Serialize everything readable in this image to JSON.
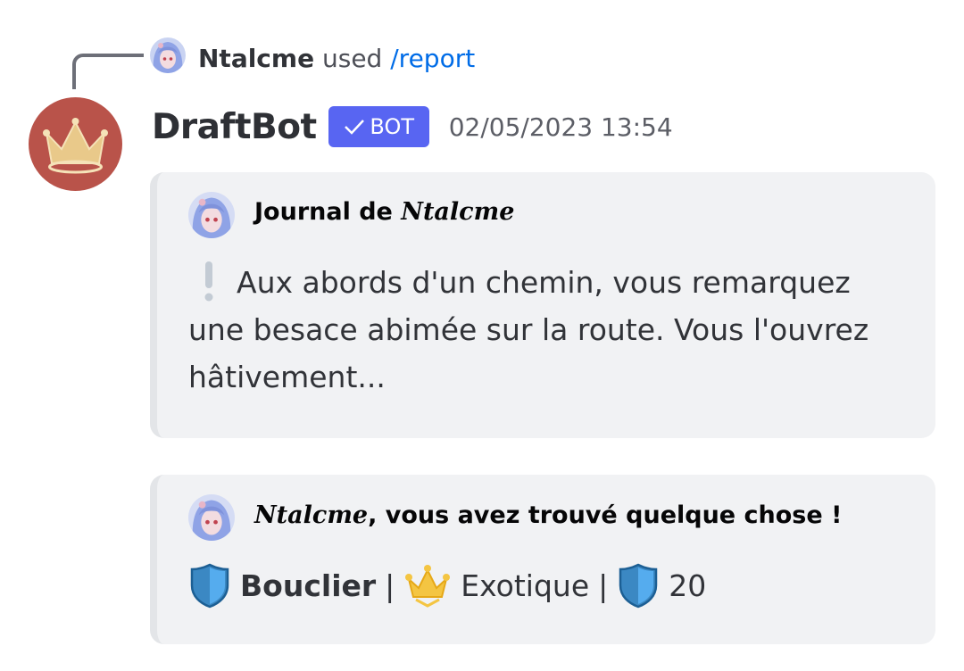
{
  "reply": {
    "username": "Ntalcme",
    "used_text": "used",
    "command": "/report"
  },
  "message": {
    "author": "DraftBot",
    "bot_tag": "BOT",
    "timestamp": "02/05/2023 13:54"
  },
  "embeds": [
    {
      "author_prefix": "Journal de ",
      "author_name": "Ntalcme",
      "description_icon": "exclamation-icon",
      "description": "Aux abords d'un chemin, vous remarquez une besace abimée sur la route. Vous l'ouvrez hâtivement..."
    },
    {
      "author_name": "Ntalcme",
      "author_suffix": ", vous avez trouvé quelque chose !",
      "item_icon": "shield-icon",
      "item_name": "Bouclier",
      "separator": "|",
      "rarity_icon": "crown-icon",
      "rarity": "Exotique",
      "stat_icon": "shield-icon",
      "stat_value": "20"
    }
  ],
  "colors": {
    "bot_tag": "#5865f2",
    "command": "#006ce7",
    "avatar_bg": "#b9534a",
    "embed_bg": "#f1f2f4"
  }
}
